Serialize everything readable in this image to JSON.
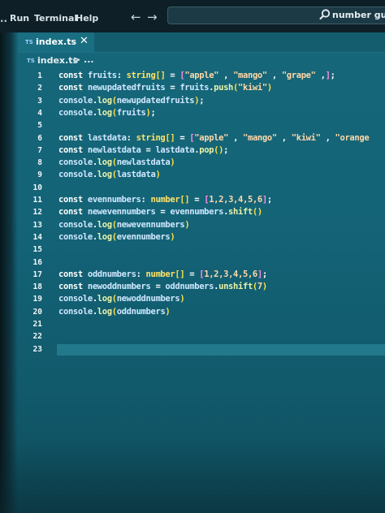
{
  "titlebar": {
    "dots": "..",
    "menu": [
      "Run",
      "Terminal",
      "Help"
    ],
    "back_arrow": "←",
    "forward_arrow": "→",
    "search_icon": "search-icon",
    "search_text": "number guessi"
  },
  "tab": {
    "icon": "TS",
    "label": "index.ts",
    "close": "✕"
  },
  "breadcrumb": {
    "icon": "TS",
    "file": "index.ts",
    "separator": "> ..."
  },
  "editor": {
    "language": "TypeScript",
    "cursor_line": 23,
    "lines": [
      {
        "n": "1",
        "tokens": [
          [
            "const ",
            "kw"
          ],
          [
            "fruits",
            "var"
          ],
          [
            ": ",
            "op"
          ],
          [
            "string",
            "ty"
          ],
          [
            "[]",
            "br"
          ],
          [
            " = ",
            "op"
          ],
          [
            "[",
            "br2"
          ],
          [
            "\"apple\"",
            "str"
          ],
          [
            " , ",
            "op"
          ],
          [
            "\"mango\"",
            "str"
          ],
          [
            " , ",
            "op"
          ],
          [
            "\"grape\"",
            "str"
          ],
          [
            " ,",
            "op"
          ],
          [
            "]",
            "br2"
          ],
          [
            ";",
            "op"
          ]
        ]
      },
      {
        "n": "2",
        "tokens": [
          [
            "const ",
            "kw"
          ],
          [
            "newupdatedfruits",
            "var"
          ],
          [
            " = ",
            "op"
          ],
          [
            "fruits",
            "var"
          ],
          [
            ".",
            "op"
          ],
          [
            "push",
            "fn"
          ],
          [
            "(",
            "br"
          ],
          [
            "\"kiwi\"",
            "str"
          ],
          [
            ")",
            "br"
          ]
        ]
      },
      {
        "n": "3",
        "tokens": [
          [
            "console",
            "var"
          ],
          [
            ".",
            "op"
          ],
          [
            "log",
            "fn"
          ],
          [
            "(",
            "br"
          ],
          [
            "newupdatedfruits",
            "var"
          ],
          [
            ")",
            "br"
          ],
          [
            ";",
            "op"
          ]
        ]
      },
      {
        "n": "4",
        "tokens": [
          [
            "console",
            "var"
          ],
          [
            ".",
            "op"
          ],
          [
            "log",
            "fn"
          ],
          [
            "(",
            "br"
          ],
          [
            "fruits",
            "var"
          ],
          [
            ")",
            "br"
          ],
          [
            ";",
            "op"
          ]
        ]
      },
      {
        "n": "5",
        "tokens": []
      },
      {
        "n": "6",
        "tokens": [
          [
            "const ",
            "kw"
          ],
          [
            "lastdata",
            "var"
          ],
          [
            ": ",
            "op"
          ],
          [
            "string",
            "ty"
          ],
          [
            "[]",
            "br"
          ],
          [
            " = ",
            "op"
          ],
          [
            "[",
            "br2"
          ],
          [
            "\"apple\"",
            "str"
          ],
          [
            " , ",
            "op"
          ],
          [
            "\"mango\"",
            "str"
          ],
          [
            " , ",
            "op"
          ],
          [
            "\"kiwi\"",
            "str"
          ],
          [
            " , ",
            "op"
          ],
          [
            "\"orange",
            "str"
          ]
        ]
      },
      {
        "n": "7",
        "tokens": [
          [
            "const ",
            "kw"
          ],
          [
            "newlastdata",
            "var"
          ],
          [
            " = ",
            "op"
          ],
          [
            "lastdata",
            "var"
          ],
          [
            ".",
            "op"
          ],
          [
            "pop",
            "fn"
          ],
          [
            "()",
            "br"
          ],
          [
            ";",
            "op"
          ]
        ]
      },
      {
        "n": "8",
        "tokens": [
          [
            "console",
            "var"
          ],
          [
            ".",
            "op"
          ],
          [
            "log",
            "fn"
          ],
          [
            "(",
            "br"
          ],
          [
            "newlastdata",
            "var"
          ],
          [
            ")",
            "br"
          ]
        ]
      },
      {
        "n": "9",
        "tokens": [
          [
            "console",
            "var"
          ],
          [
            ".",
            "op"
          ],
          [
            "log",
            "fn"
          ],
          [
            "(",
            "br"
          ],
          [
            "lastdata",
            "var"
          ],
          [
            ")",
            "br"
          ]
        ]
      },
      {
        "n": "10",
        "tokens": []
      },
      {
        "n": "11",
        "tokens": [
          [
            "const ",
            "kw"
          ],
          [
            "evennumbers",
            "var"
          ],
          [
            ": ",
            "op"
          ],
          [
            "number",
            "ty"
          ],
          [
            "[]",
            "br"
          ],
          [
            " = ",
            "op"
          ],
          [
            "[",
            "br2"
          ],
          [
            "1,2,3,4,5,6",
            "num"
          ],
          [
            "]",
            "br2"
          ],
          [
            ";",
            "op"
          ]
        ]
      },
      {
        "n": "12",
        "tokens": [
          [
            "const ",
            "kw"
          ],
          [
            "newevennumbers",
            "var"
          ],
          [
            " = ",
            "op"
          ],
          [
            "evennumbers",
            "var"
          ],
          [
            ".",
            "op"
          ],
          [
            "shift",
            "fn"
          ],
          [
            "()",
            "br"
          ]
        ]
      },
      {
        "n": "13",
        "tokens": [
          [
            "console",
            "var"
          ],
          [
            ".",
            "op"
          ],
          [
            "log",
            "fn"
          ],
          [
            "(",
            "br"
          ],
          [
            "newevennumbers",
            "var"
          ],
          [
            ")",
            "br"
          ]
        ]
      },
      {
        "n": "14",
        "tokens": [
          [
            "console",
            "var"
          ],
          [
            ".",
            "op"
          ],
          [
            "log",
            "fn"
          ],
          [
            "(",
            "br"
          ],
          [
            "evennumbers",
            "var"
          ],
          [
            ")",
            "br"
          ]
        ]
      },
      {
        "n": "15",
        "tokens": []
      },
      {
        "n": "16",
        "tokens": []
      },
      {
        "n": "17",
        "tokens": [
          [
            "const ",
            "kw"
          ],
          [
            "oddnumbers",
            "var"
          ],
          [
            ": ",
            "op"
          ],
          [
            "number",
            "ty"
          ],
          [
            "[]",
            "br"
          ],
          [
            " = ",
            "op"
          ],
          [
            "[",
            "br2"
          ],
          [
            "1,2,3,4,5,6",
            "num"
          ],
          [
            "]",
            "br2"
          ],
          [
            ";",
            "op"
          ]
        ]
      },
      {
        "n": "18",
        "tokens": [
          [
            "const ",
            "kw"
          ],
          [
            "newoddnumbers",
            "var"
          ],
          [
            " = ",
            "op"
          ],
          [
            "oddnumbers",
            "var"
          ],
          [
            ".",
            "op"
          ],
          [
            "unshift",
            "fn"
          ],
          [
            "(",
            "br"
          ],
          [
            "7",
            "num"
          ],
          [
            ")",
            "br"
          ]
        ]
      },
      {
        "n": "19",
        "tokens": [
          [
            "console",
            "var"
          ],
          [
            ".",
            "op"
          ],
          [
            "log",
            "fn"
          ],
          [
            "(",
            "br"
          ],
          [
            "newoddnumbers",
            "var"
          ],
          [
            ")",
            "br"
          ]
        ]
      },
      {
        "n": "20",
        "tokens": [
          [
            "console",
            "var"
          ],
          [
            ".",
            "op"
          ],
          [
            "log",
            "fn"
          ],
          [
            "(",
            "br"
          ],
          [
            "oddnumbers",
            "var"
          ],
          [
            ")",
            "br"
          ]
        ]
      },
      {
        "n": "21",
        "tokens": []
      },
      {
        "n": "22",
        "tokens": []
      },
      {
        "n": "23",
        "tokens": []
      }
    ]
  },
  "colors": {
    "editor_bg": "#146478",
    "titlebar_bg": "#0e1f27",
    "line_highlight": "#2a8396"
  }
}
